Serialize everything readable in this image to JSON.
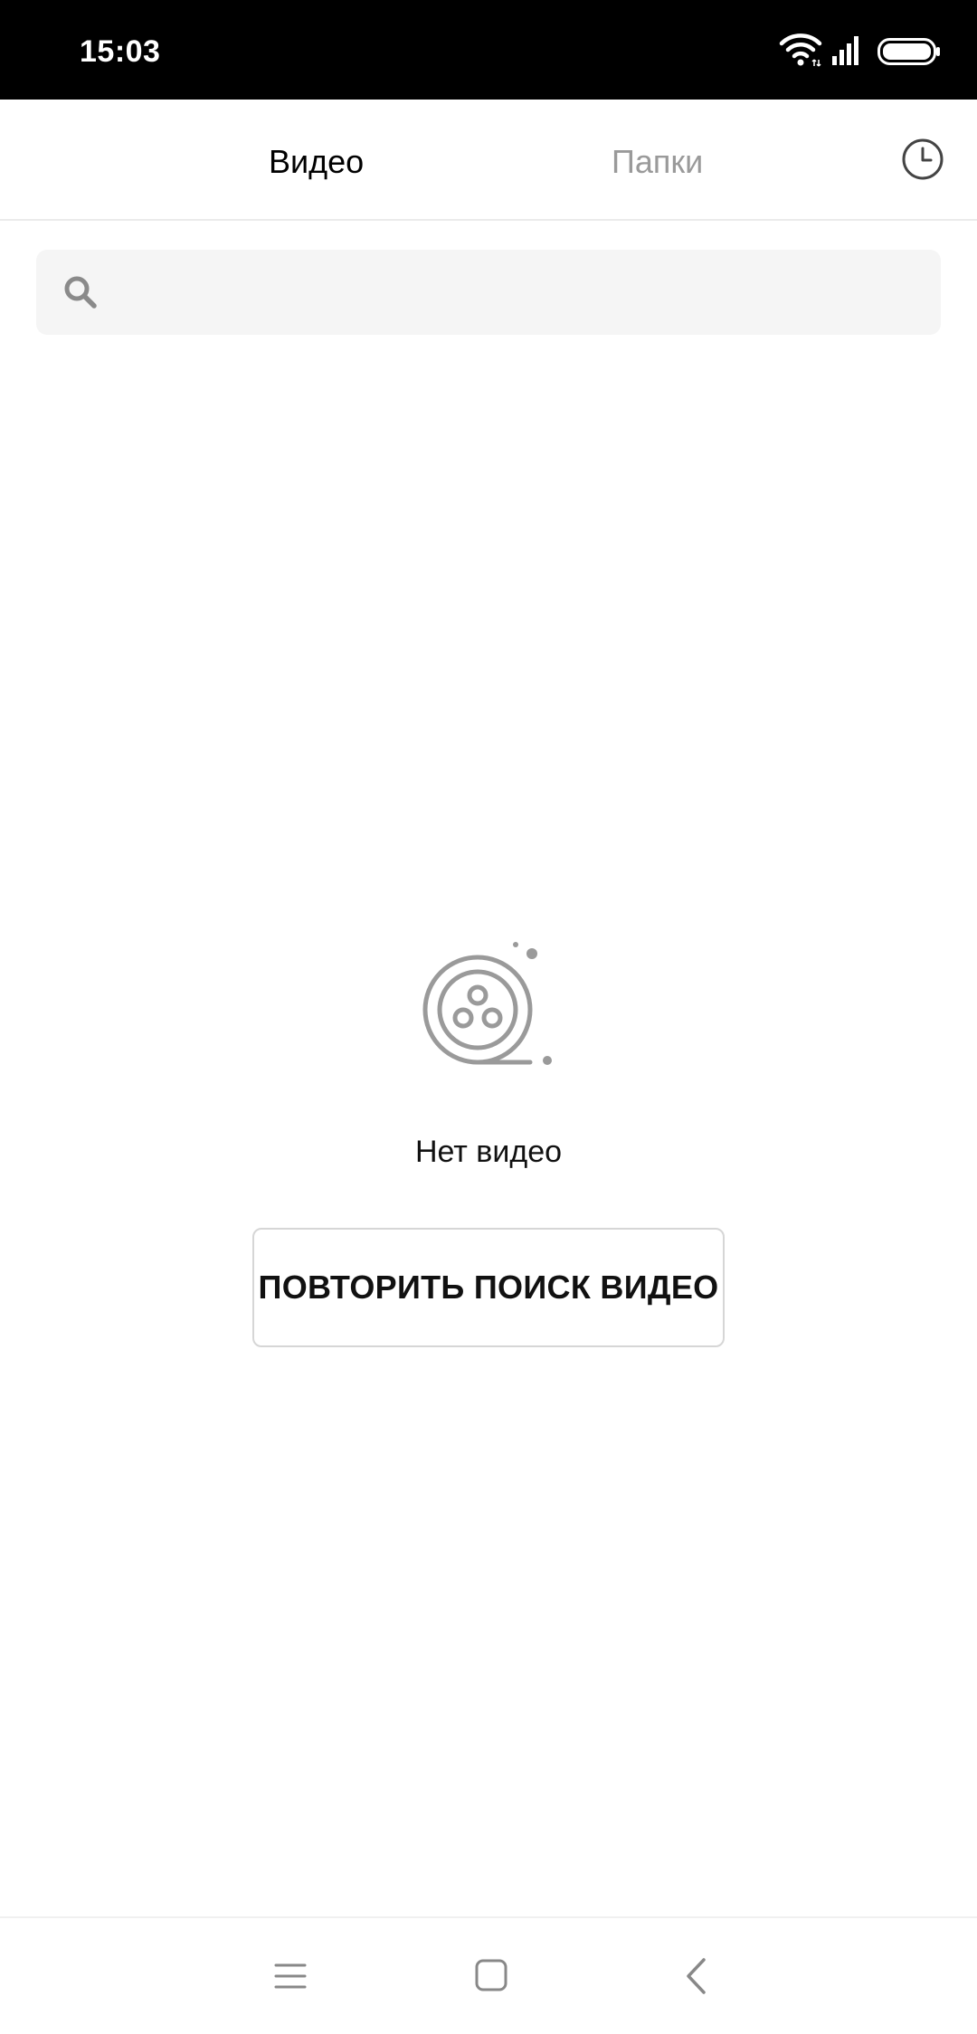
{
  "status_bar": {
    "time": "15:03",
    "icons": [
      "wifi-icon",
      "signal-icon",
      "battery-icon"
    ]
  },
  "tabs": [
    {
      "label": "Видео",
      "active": true
    },
    {
      "label": "Папки",
      "active": false
    }
  ],
  "header": {
    "history_icon": "clock-icon"
  },
  "search": {
    "placeholder": "",
    "icon": "search-icon"
  },
  "empty_state": {
    "icon": "film-reel-icon",
    "message": "Нет видео",
    "button_label": "ПОВТОРИТЬ ПОИСК ВИДЕО"
  },
  "nav_bar": {
    "icons": [
      "menu-icon",
      "home-icon",
      "back-icon"
    ]
  },
  "colors": {
    "status_bar_bg": "#000000",
    "active_tab": "#000000",
    "inactive_tab": "#9a9a9a",
    "search_bg": "#f5f5f5",
    "icon_gray": "#8a8a8a"
  }
}
